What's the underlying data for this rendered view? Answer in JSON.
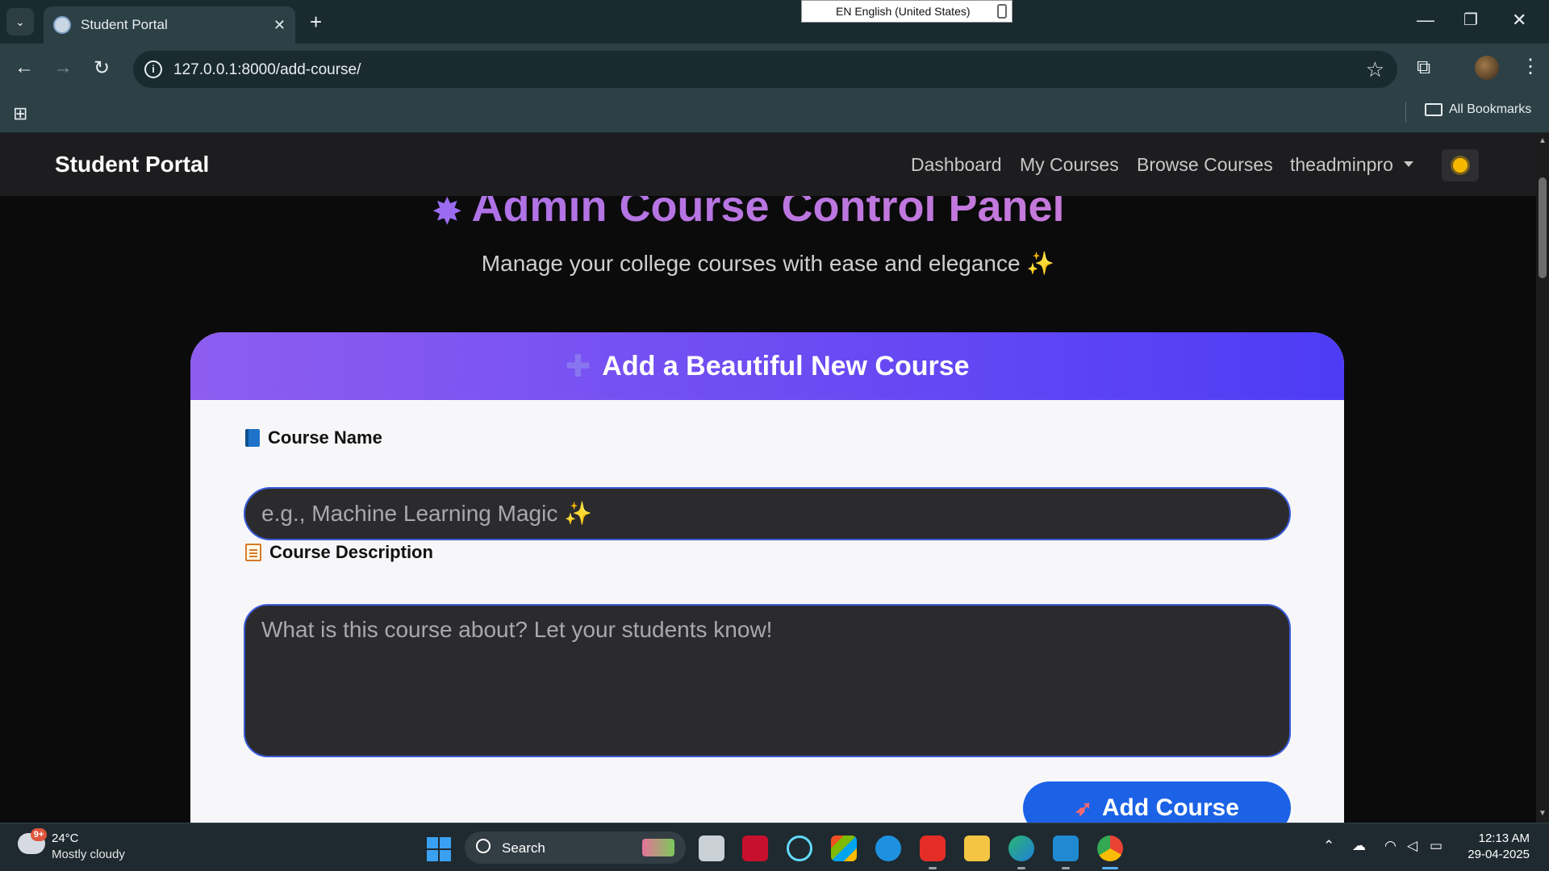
{
  "browser": {
    "tab_title": "Student Portal",
    "url": "127.0.0.1:8000/add-course/",
    "ime_text": "EN English (United States)",
    "bookmarks_label": "All Bookmarks"
  },
  "navbar": {
    "brand": "Student Portal",
    "links": [
      "Dashboard",
      "My Courses",
      "Browse Courses"
    ],
    "user": "theadminpro"
  },
  "hero": {
    "title": "Admin Course Control Panel",
    "subtitle": "Manage your college courses with ease and elegance ✨"
  },
  "form": {
    "header": "Add a Beautiful New Course",
    "name_label": "Course Name",
    "name_placeholder": "e.g., Machine Learning Magic ✨",
    "desc_label": "Course Description",
    "desc_placeholder": "What is this course about? Let your students know!",
    "submit_label": "Add Course"
  },
  "taskbar": {
    "weather_temp": "24°C",
    "weather_desc": "Mostly cloudy",
    "weather_badge": "9+",
    "search_label": "Search",
    "time": "12:13 AM",
    "date": "29-04-2025"
  },
  "colors": {
    "accent_gradient_start": "#8e5df0",
    "accent_gradient_end": "#4d3cf5",
    "button_blue": "#1b62e6",
    "input_border": "#3a5bd6"
  },
  "icons": {
    "heading": "puzzle-icon",
    "header": "plus-icon",
    "name": "book-icon",
    "desc": "memo-icon",
    "submit": "rocket-icon",
    "theme": "sun-icon"
  }
}
